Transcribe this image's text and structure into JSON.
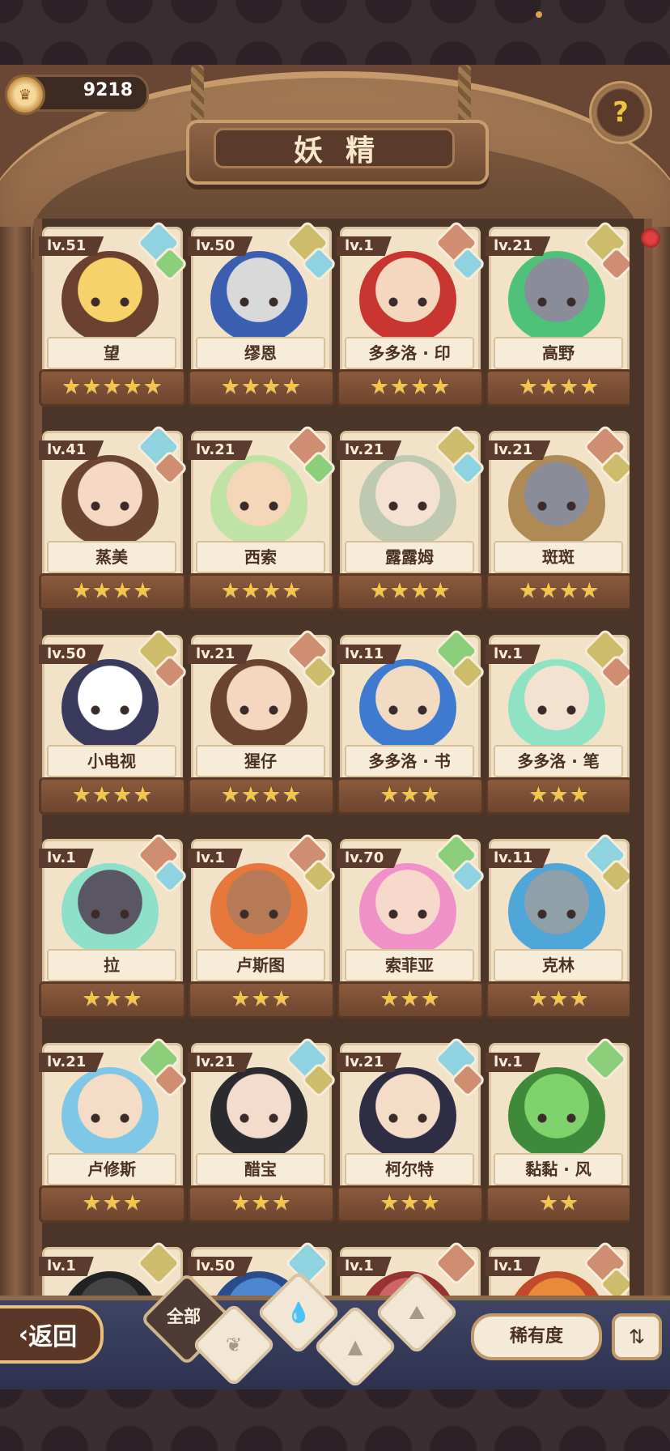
{
  "coins": "9218",
  "title": "妖精",
  "back_label": "返回",
  "filter_all_label": "全部",
  "rarity_label": "稀有度",
  "colors": {
    "water": "#8fd3e0",
    "earth": "#cdbd6a",
    "fire": "#cf8d72",
    "grass": "#8bcf7a",
    "star": "#f3c54a"
  },
  "cards": [
    {
      "level": "lv.51",
      "name": "望",
      "stars": "★★★★★",
      "elements": [
        "water",
        "grass"
      ],
      "palette": [
        "#f7d26a",
        "#6a4030"
      ]
    },
    {
      "level": "lv.50",
      "name": "缪恩",
      "stars": "★★★★",
      "elements": [
        "earth",
        "water"
      ],
      "palette": [
        "#d9d9d9",
        "#3b5fb0"
      ]
    },
    {
      "level": "lv.1",
      "name": "多多洛 · 印",
      "stars": "★★★★",
      "elements": [
        "fire",
        "water"
      ],
      "palette": [
        "#f5d7c0",
        "#c8342f"
      ]
    },
    {
      "level": "lv.21",
      "name": "高野",
      "stars": "★★★★",
      "elements": [
        "earth",
        "fire"
      ],
      "palette": [
        "#8a8c9a",
        "#4fc27a"
      ]
    },
    {
      "level": "lv.41",
      "name": "蒸美",
      "stars": "★★★★",
      "elements": [
        "water",
        "fire"
      ],
      "palette": [
        "#f6d9c4",
        "#6b4532"
      ]
    },
    {
      "level": "lv.21",
      "name": "西索",
      "stars": "★★★★",
      "elements": [
        "fire",
        "grass"
      ],
      "palette": [
        "#f3d7b8",
        "#bfe3a4"
      ]
    },
    {
      "level": "lv.21",
      "name": "露露姆",
      "stars": "★★★★",
      "elements": [
        "earth",
        "water"
      ],
      "palette": [
        "#f4e1d2",
        "#bfc8b0"
      ]
    },
    {
      "level": "lv.21",
      "name": "斑斑",
      "stars": "★★★★",
      "elements": [
        "fire",
        "earth"
      ],
      "palette": [
        "#8a8c98",
        "#b08a55"
      ]
    },
    {
      "level": "lv.50",
      "name": "小电视",
      "stars": "★★★★",
      "elements": [
        "earth",
        "fire"
      ],
      "palette": [
        "#ffffff",
        "#3a3b5c"
      ]
    },
    {
      "level": "lv.21",
      "name": "猩仔",
      "stars": "★★★★",
      "elements": [
        "fire",
        "earth"
      ],
      "palette": [
        "#f5d7bf",
        "#6a4430"
      ]
    },
    {
      "level": "lv.11",
      "name": "多多洛 · 书",
      "stars": "★★★",
      "elements": [
        "grass",
        "earth"
      ],
      "palette": [
        "#f2dbc2",
        "#3e7bd0"
      ]
    },
    {
      "level": "lv.1",
      "name": "多多洛 · 笔",
      "stars": "★★★",
      "elements": [
        "earth",
        "fire"
      ],
      "palette": [
        "#f4e2d0",
        "#8fe3c4"
      ]
    },
    {
      "level": "lv.1",
      "name": "拉",
      "stars": "★★★",
      "elements": [
        "fire",
        "water"
      ],
      "palette": [
        "#5b5664",
        "#8fe0c8"
      ]
    },
    {
      "level": "lv.1",
      "name": "卢斯图",
      "stars": "★★★",
      "elements": [
        "fire",
        "earth"
      ],
      "palette": [
        "#b77a56",
        "#e7773a"
      ]
    },
    {
      "level": "lv.70",
      "name": "索菲亚",
      "stars": "★★★",
      "elements": [
        "grass",
        "water"
      ],
      "palette": [
        "#f6d9cb",
        "#f090c8"
      ]
    },
    {
      "level": "lv.11",
      "name": "克林",
      "stars": "★★★",
      "elements": [
        "water",
        "earth"
      ],
      "palette": [
        "#8fa0a8",
        "#4fa6d8"
      ]
    },
    {
      "level": "lv.21",
      "name": "卢修斯",
      "stars": "★★★",
      "elements": [
        "grass",
        "fire"
      ],
      "palette": [
        "#f4dcc6",
        "#7ec7e6"
      ]
    },
    {
      "level": "lv.21",
      "name": "醋宝",
      "stars": "★★★",
      "elements": [
        "water",
        "earth"
      ],
      "palette": [
        "#f4dccc",
        "#2b2a2e"
      ]
    },
    {
      "level": "lv.21",
      "name": "柯尔特",
      "stars": "★★★",
      "elements": [
        "water",
        "fire"
      ],
      "palette": [
        "#f4dcc6",
        "#2f2d44"
      ]
    },
    {
      "level": "lv.1",
      "name": "黏黏 · 风",
      "stars": "★★",
      "elements": [
        "grass"
      ],
      "palette": [
        "#7ed36a",
        "#3e8a3a"
      ]
    },
    {
      "level": "lv.1",
      "name": "",
      "stars": "",
      "elements": [
        "earth"
      ],
      "palette": [
        "#444",
        "#222"
      ]
    },
    {
      "level": "lv.50",
      "name": "",
      "stars": "",
      "elements": [
        "water"
      ],
      "palette": [
        "#4f86d0",
        "#2a4c88"
      ]
    },
    {
      "level": "lv.1",
      "name": "",
      "stars": "",
      "elements": [
        "fire"
      ],
      "palette": [
        "#c66",
        "#933"
      ]
    },
    {
      "level": "lv.1",
      "name": "",
      "stars": "",
      "elements": [
        "fire",
        "earth"
      ],
      "palette": [
        "#e88a3a",
        "#c24a2a"
      ]
    }
  ],
  "filters": [
    {
      "icon": "sprout-icon",
      "glyph": "❦"
    },
    {
      "icon": "water-drop-icon",
      "glyph": "💧"
    },
    {
      "icon": "rock-icon",
      "glyph": "▲"
    },
    {
      "icon": "mountain-icon",
      "glyph": "⛰"
    }
  ]
}
